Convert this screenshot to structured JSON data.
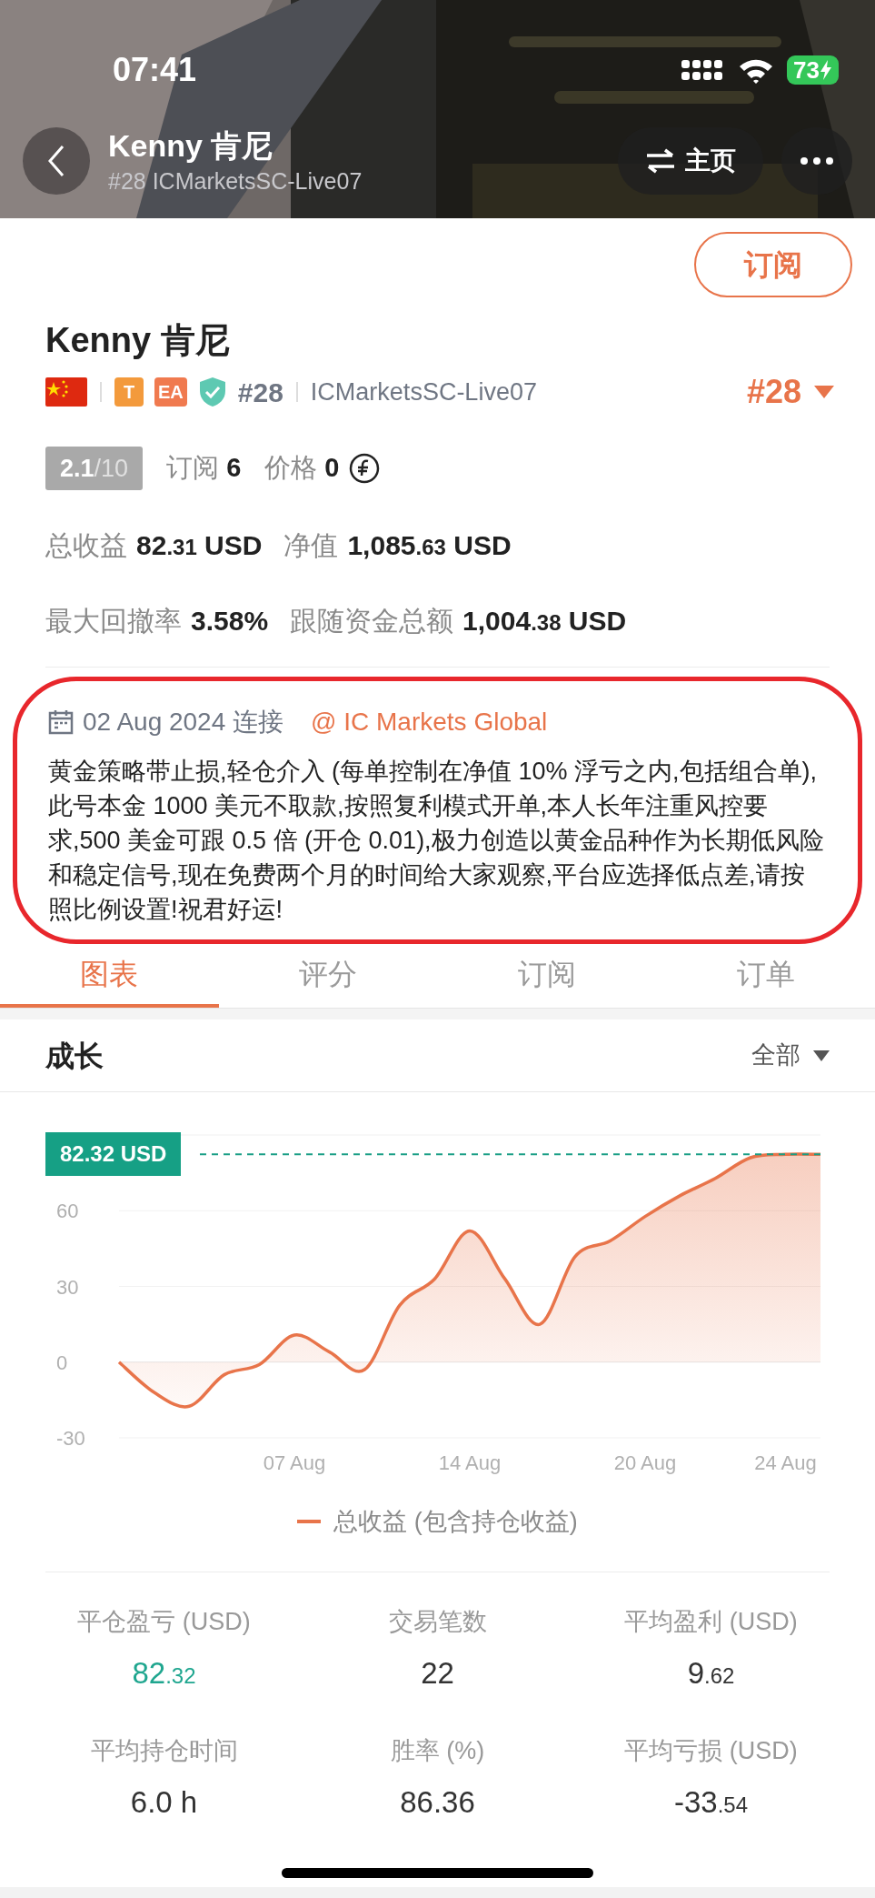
{
  "status_bar": {
    "time": "07:41",
    "battery": "73"
  },
  "header": {
    "title": "Kenny 肯尼",
    "subtitle": "#28 ICMarketsSC-Live07",
    "home_button": "主页"
  },
  "subscribe_button": "订阅",
  "profile": {
    "name": "Kenny 肯尼",
    "badges": [
      {
        "kind": "flag"
      },
      {
        "kind": "letter",
        "label": "T",
        "color": "#f39a3c"
      },
      {
        "kind": "letter",
        "label": "EA",
        "color": "#f07a4f"
      },
      {
        "kind": "shield"
      }
    ],
    "rank": "#28",
    "server": "ICMarketsSC-Live07",
    "rank_select": "#28"
  },
  "rating": {
    "score": "2.1",
    "scale": "/10"
  },
  "counts": [
    {
      "label": "订阅",
      "value": "6"
    },
    {
      "label": "价格",
      "value": "0"
    }
  ],
  "stats": [
    [
      {
        "label": "总收益",
        "main": "82",
        "fraction": ".31",
        "unit": "USD"
      },
      {
        "label": "净值",
        "main": "1,085",
        "fraction": ".63",
        "unit": "USD"
      }
    ],
    [
      {
        "label": "最大回撤率",
        "main": "3.58%"
      },
      {
        "label": "跟随资金总额",
        "main": "1,004",
        "fraction": ".38",
        "unit": "USD"
      }
    ]
  ],
  "connection": {
    "date": "02 Aug 2024 连接",
    "broker": "@ IC Markets Global"
  },
  "description": "黄金策略带止损,轻仓介入 (每单控制在净值 10% 浮亏之内,包括组合单),此号本金 1000 美元不取款,按照复利模式开单,本人长年注重风控要求,500 美金可跟 0.5 倍 (开仓 0.01),极力创造以黄金品种作为长期低风险和稳定信号,现在免费两个月的时间给大家观察,平台应选择低点差,请按照比例设置!祝君好运!",
  "tabs": [
    {
      "label": "图表",
      "selected": true
    },
    {
      "label": "评分",
      "selected": false
    },
    {
      "label": "订阅",
      "selected": false
    },
    {
      "label": "订单",
      "selected": false
    }
  ],
  "growth": {
    "title": "成长",
    "range": "全部",
    "chart_data": {
      "type": "area",
      "categories": [
        null,
        null,
        null,
        null,
        null,
        "07 Aug",
        null,
        null,
        null,
        null,
        "14 Aug",
        null,
        null,
        null,
        null,
        "20 Aug",
        null,
        null,
        null,
        "24 Aug",
        null
      ],
      "series": [
        {
          "name": "总收益 (包含持仓收益)",
          "color": "#e8744a",
          "values": [
            0,
            -12,
            -17.5,
            -5,
            -1,
            10.7,
            4,
            -3,
            22.5,
            33,
            52,
            33,
            15,
            41.8,
            48,
            57.7,
            66,
            72.8,
            81,
            82.3,
            82.3
          ]
        }
      ],
      "ylim": [
        -30,
        90
      ],
      "yticks": [
        -30,
        0,
        30,
        60
      ],
      "ref_lines": [
        {
          "axis": "y",
          "value": 82.3,
          "color": "#1a9e86"
        }
      ],
      "annotations": [
        "82.32 USD"
      ]
    }
  },
  "summary": [
    {
      "label": "平仓盈亏 (USD)",
      "main": "82",
      "fraction": ".32",
      "color": "#1fa68f"
    },
    {
      "label": "交易笔数",
      "main": "22",
      "color": "#333333"
    },
    {
      "label": "平均盈利 (USD)",
      "main": "9",
      "fraction": ".62",
      "color": "#333333"
    },
    {
      "label": "平均持仓时间",
      "main": "6.0 h",
      "color": "#333333"
    },
    {
      "label": "胜率 (%)",
      "main": "86.36",
      "color": "#333333"
    },
    {
      "label": "平均亏损 (USD)",
      "main": "-33",
      "fraction": ".54",
      "color": "#333333"
    }
  ]
}
